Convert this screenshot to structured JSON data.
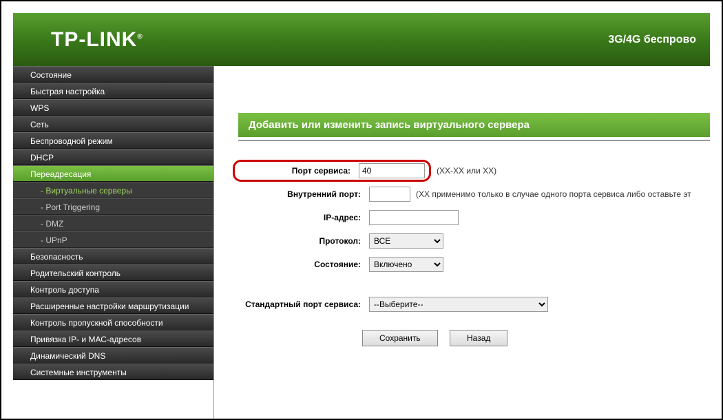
{
  "header": {
    "logo": "TP-LINK",
    "tagline": "3G/4G беспрово"
  },
  "sidebar": {
    "items": [
      {
        "label": "Состояние",
        "type": "item"
      },
      {
        "label": "Быстрая настройка",
        "type": "item"
      },
      {
        "label": "WPS",
        "type": "item"
      },
      {
        "label": "Сеть",
        "type": "item"
      },
      {
        "label": "Беспроводной режим",
        "type": "item"
      },
      {
        "label": "DHCP",
        "type": "item"
      },
      {
        "label": "Переадресация",
        "type": "item",
        "active": true
      },
      {
        "label": "- Виртуальные серверы",
        "type": "sub",
        "active": true
      },
      {
        "label": "- Port Triggering",
        "type": "sub"
      },
      {
        "label": "- DMZ",
        "type": "sub"
      },
      {
        "label": "- UPnP",
        "type": "sub"
      },
      {
        "label": "Безопасность",
        "type": "item"
      },
      {
        "label": "Родительский контроль",
        "type": "item"
      },
      {
        "label": "Контроль доступа",
        "type": "item"
      },
      {
        "label": "Расширенные настройки маршрутизации",
        "type": "item"
      },
      {
        "label": "Контроль пропускной способности",
        "type": "item"
      },
      {
        "label": "Привязка IP- и МАС-адресов",
        "type": "item"
      },
      {
        "label": "Динамический DNS",
        "type": "item"
      },
      {
        "label": "Системные инструменты",
        "type": "item"
      }
    ]
  },
  "page": {
    "title": "Добавить или изменить запись виртуального сервера"
  },
  "form": {
    "service_port_label": "Порт сервиса:",
    "service_port_value": "40",
    "service_port_hint": "(XX-XX или XX)",
    "internal_port_label": "Внутренний порт:",
    "internal_port_value": "",
    "internal_port_hint": "(XX применимо только в случае одного порта сервиса либо оставьте эт",
    "ip_label": "IP-адрес:",
    "ip_value": "",
    "protocol_label": "Протокол:",
    "protocol_value": "ВСЕ",
    "status_label": "Состояние:",
    "status_value": "Включено",
    "standard_port_label": "Стандартный порт сервиса:",
    "standard_port_value": "--Выберите--"
  },
  "buttons": {
    "save": "Сохранить",
    "back": "Назад"
  }
}
